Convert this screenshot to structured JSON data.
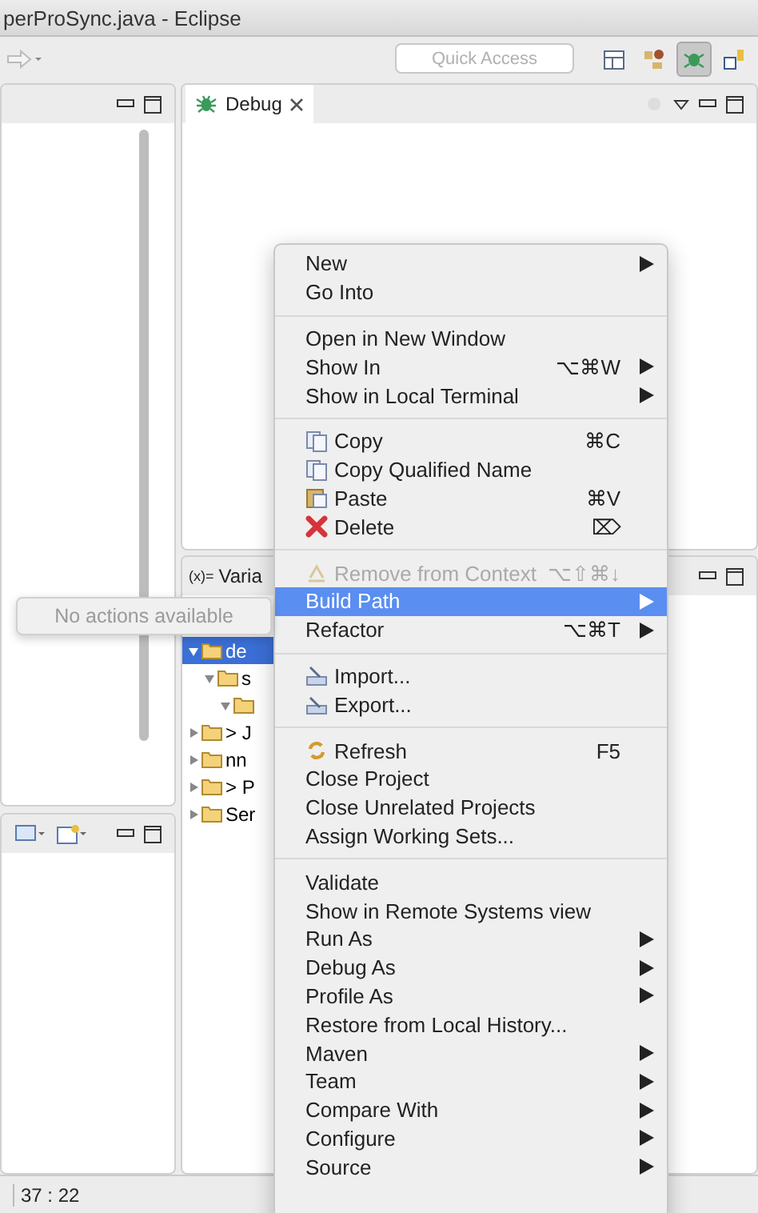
{
  "window": {
    "title": "perProSync.java - Eclipse"
  },
  "toolbar": {
    "quick_access": {
      "placeholder": "Quick Access"
    },
    "perspectives": [
      {
        "selected": false
      },
      {
        "selected": false
      },
      {
        "selected": true
      },
      {
        "selected": false
      }
    ]
  },
  "debug_view": {
    "tab": "Debug"
  },
  "variables_view": {
    "tab_icon": "(x)=",
    "tab": "Varia",
    "tree": [
      {
        "label": "de",
        "selected": true,
        "expanded": true,
        "children": [
          {
            "label": "s",
            "selected": false,
            "expanded": true,
            "children": [
              {
                "selected": false,
                "expanded": true
              }
            ]
          }
        ]
      },
      {
        "label": "> J",
        "selected": false,
        "expanded": false
      },
      {
        "label": "nn",
        "selected": false,
        "expanded": false
      },
      {
        "label": "> P",
        "selected": false,
        "expanded": false
      },
      {
        "label": "Ser",
        "selected": false,
        "expanded": false
      }
    ]
  },
  "tooltip": {
    "text": "No actions available"
  },
  "context_menu": {
    "groups": [
      [
        {
          "kind": "text",
          "label": "New",
          "submenu": true,
          "disabled": false,
          "selected": false
        },
        {
          "kind": "text",
          "label": "Go Into",
          "submenu": false,
          "disabled": false,
          "selected": false
        }
      ],
      [
        {
          "kind": "text",
          "label": "Open in New Window",
          "submenu": false,
          "disabled": false,
          "selected": false
        },
        {
          "kind": "text",
          "label": "Show In",
          "shortcut": "⌥⌘W",
          "submenu": true,
          "disabled": false,
          "selected": false
        },
        {
          "kind": "text",
          "label": "Show in Local Terminal",
          "submenu": true,
          "disabled": false,
          "selected": false
        }
      ],
      [
        {
          "kind": "copy",
          "label": "Copy",
          "shortcut": "⌘C",
          "submenu": false,
          "disabled": false,
          "selected": false
        },
        {
          "kind": "copy",
          "label": "Copy Qualified Name",
          "submenu": false,
          "disabled": false,
          "selected": false
        },
        {
          "kind": "paste",
          "label": "Paste",
          "shortcut": "⌘V",
          "submenu": false,
          "disabled": false,
          "selected": false
        },
        {
          "kind": "delete",
          "label": "Delete",
          "shortcut": "⌦",
          "submenu": false,
          "disabled": false,
          "selected": false
        }
      ],
      [
        {
          "kind": "remove",
          "label": "Remove from Context",
          "shortcut": "⌥⇧⌘↓",
          "submenu": false,
          "disabled": true,
          "selected": false
        },
        {
          "kind": "text",
          "label": "Build Path",
          "submenu": true,
          "disabled": false,
          "selected": true
        },
        {
          "kind": "text",
          "label": "Refactor",
          "shortcut": "⌥⌘T",
          "submenu": true,
          "disabled": false,
          "selected": false
        }
      ],
      [
        {
          "kind": "import",
          "label": "Import...",
          "submenu": false,
          "disabled": false,
          "selected": false
        },
        {
          "kind": "export",
          "label": "Export...",
          "submenu": false,
          "disabled": false,
          "selected": false
        }
      ],
      [
        {
          "kind": "refresh",
          "label": "Refresh",
          "shortcut": "F5",
          "submenu": false,
          "disabled": false,
          "selected": false
        },
        {
          "kind": "text",
          "label": "Close Project",
          "submenu": false,
          "disabled": false,
          "selected": false
        },
        {
          "kind": "text",
          "label": "Close Unrelated Projects",
          "submenu": false,
          "disabled": false,
          "selected": false
        },
        {
          "kind": "text",
          "label": "Assign Working Sets...",
          "submenu": false,
          "disabled": false,
          "selected": false
        }
      ],
      [
        {
          "kind": "text",
          "label": "Validate",
          "submenu": false,
          "disabled": false,
          "selected": false
        },
        {
          "kind": "text",
          "label": "Show in Remote Systems view",
          "submenu": false,
          "disabled": false,
          "selected": false
        },
        {
          "kind": "text",
          "label": "Run As",
          "submenu": true,
          "disabled": false,
          "selected": false
        },
        {
          "kind": "text",
          "label": "Debug As",
          "submenu": true,
          "disabled": false,
          "selected": false
        },
        {
          "kind": "text",
          "label": "Profile As",
          "submenu": true,
          "disabled": false,
          "selected": false
        },
        {
          "kind": "text",
          "label": "Restore from Local History...",
          "submenu": false,
          "disabled": false,
          "selected": false
        },
        {
          "kind": "text",
          "label": "Maven",
          "submenu": true,
          "disabled": false,
          "selected": false
        },
        {
          "kind": "text",
          "label": "Team",
          "submenu": true,
          "disabled": false,
          "selected": false
        },
        {
          "kind": "text",
          "label": "Compare With",
          "submenu": true,
          "disabled": false,
          "selected": false
        },
        {
          "kind": "text",
          "label": "Configure",
          "submenu": true,
          "disabled": false,
          "selected": false
        },
        {
          "kind": "text",
          "label": "Source",
          "submenu": true,
          "disabled": false,
          "selected": false
        }
      ]
    ]
  },
  "status_bar": {
    "position": "37 : 22"
  }
}
